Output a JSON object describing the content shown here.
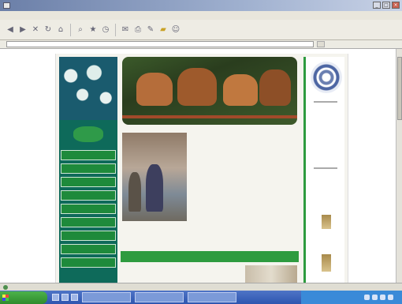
{
  "window": {
    "title": ""
  },
  "menubar": {
    "items": [
      "",
      "",
      "",
      "",
      "",
      ""
    ]
  },
  "toolbar": {
    "buttons": [
      "back-icon",
      "forward-icon",
      "stop-icon",
      "refresh-icon",
      "home-icon",
      "search-icon",
      "favorites-icon",
      "history-icon",
      "mail-icon",
      "print-icon",
      "edit-icon",
      "discuss-icon",
      "messenger-icon"
    ]
  },
  "addressbar": {
    "label": "",
    "url": "",
    "go_label": ""
  },
  "site": {
    "tagline": "",
    "nav": [
      "",
      "",
      "",
      "",
      "",
      "",
      "",
      "",
      ""
    ],
    "intro_paragraphs": [
      "",
      ""
    ],
    "body_paragraph": "",
    "banner": "",
    "bottom_caption": ""
  },
  "sponsors": [
    "",
    "",
    "",
    "",
    "",
    ""
  ],
  "statusbar": {
    "status": "",
    "zone": ""
  },
  "taskbar": {
    "start_label": "",
    "tasks": [
      "",
      "",
      ""
    ],
    "clock": ""
  },
  "colors": {
    "green": "#2e9b3f",
    "teal": "#0e6a5a",
    "titlebar": "#6b7fa8",
    "taskbar": "#2e56b0"
  }
}
